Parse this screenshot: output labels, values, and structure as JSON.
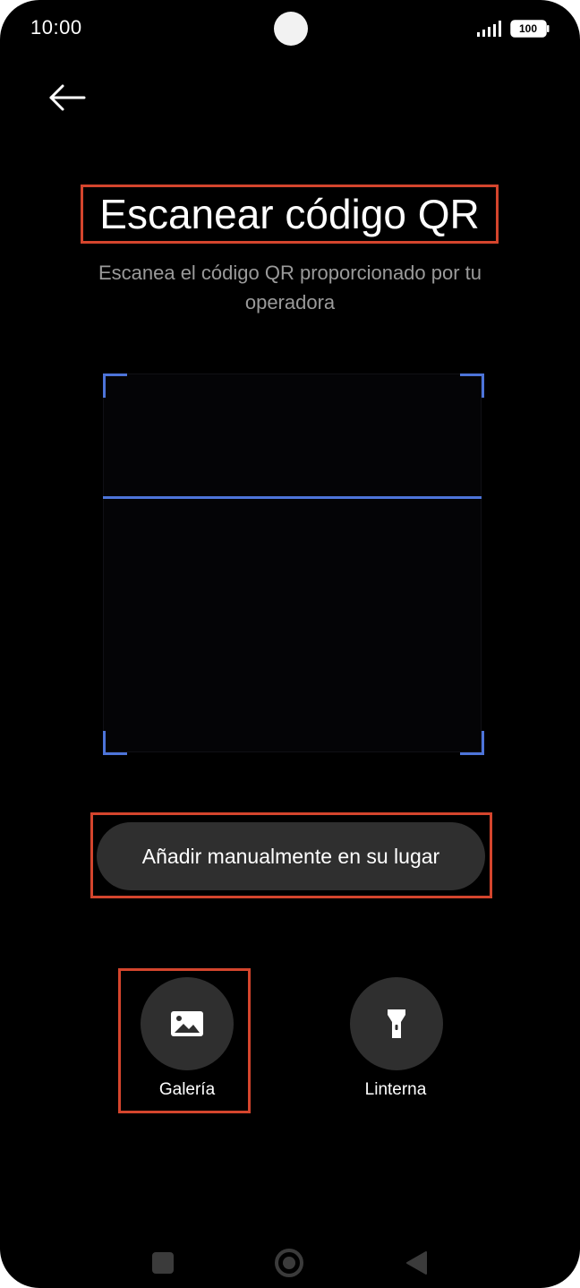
{
  "status_bar": {
    "time": "10:00",
    "battery": "100",
    "signal_icon": "signal-bars-icon",
    "battery_icon": "battery-icon"
  },
  "header": {
    "back_icon": "arrow-left-icon",
    "title": "Escanear código QR",
    "subtitle": "Escanea el código QR proporcionado por tu operadora"
  },
  "scanner": {
    "accent_color": "#4d74d9"
  },
  "actions": {
    "manual_label": "Añadir manualmente en su lugar",
    "gallery_label": "Galería",
    "gallery_icon": "image-icon",
    "flashlight_label": "Linterna",
    "flashlight_icon": "flashlight-icon"
  },
  "nav_bar": {
    "recents_icon": "square-icon",
    "home_icon": "circle-home-icon",
    "back_icon": "triangle-back-icon"
  },
  "highlight_color": "#d4452d"
}
